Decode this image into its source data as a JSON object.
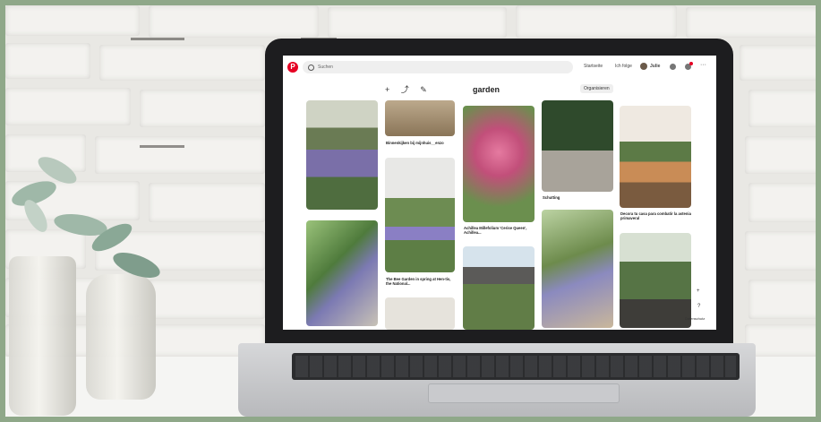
{
  "pinterest": {
    "logo_letter": "P",
    "search_placeholder": "Suchen",
    "nav_startseite": "Startseite",
    "nav_ich_folge": "Ich folge",
    "nav_user": "Julie",
    "toolbar_icons": "+ ⤴ ✎",
    "board_title": "garden",
    "organize_label": "Organisieren",
    "side_plus": "+",
    "side_help": "?",
    "datenschutz": "Datenschutz"
  },
  "pins": [
    {
      "caption": "Binnenkijken bij mijnhuis__enzo"
    },
    {
      "caption": "The Bee Garden in spring at Hen-tis, the National..."
    },
    {
      "caption": "Achillea Millefolium 'Cerise Queen', Achillea..."
    },
    {
      "caption": "Schutting"
    },
    {
      "caption": "Decora tu casa para combatir la astenia primaveral"
    }
  ],
  "colors": {
    "frame": "#8fa889",
    "brand": "#e60023"
  }
}
